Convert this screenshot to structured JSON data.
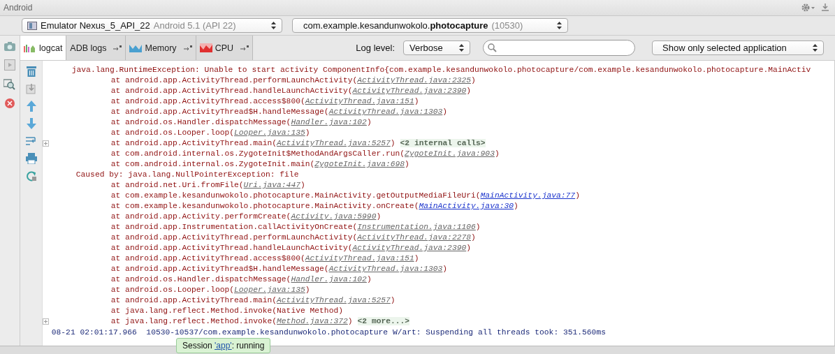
{
  "window": {
    "title": "Android"
  },
  "device_selector": {
    "device": "Emulator Nexus_5_API_22",
    "detail": "Android 5.1 (API 22)"
  },
  "process_selector": {
    "process": "com.example.kesandunwokolo.**photocapture**",
    "pid": "(10530)"
  },
  "tabs": [
    {
      "label": "logcat",
      "kind": "logcat",
      "selected": true,
      "detachable": false
    },
    {
      "label": "ADB logs",
      "kind": "adb",
      "selected": false,
      "detachable": true
    },
    {
      "label": "Memory",
      "kind": "memory",
      "selected": false,
      "detachable": true
    },
    {
      "label": "CPU",
      "kind": "cpu",
      "selected": false,
      "detachable": true
    }
  ],
  "log_level": {
    "label": "Log level:",
    "value": "Verbose"
  },
  "filter": {
    "value": "Show only selected application"
  },
  "log_lines": [
    {
      "kind": "exception",
      "segments": [
        {
          "kind": "text",
          "text": "java.lang.RuntimeException: Unable to start activity ComponentInfo{com.example.kesandunwokolo.photocapture/com.example.kesandunwokolo.photocapture.MainActiv"
        }
      ]
    },
    {
      "kind": "frame",
      "segments": [
        {
          "kind": "text",
          "text": "at android.app.ActivityThread.performLaunchActivity("
        },
        {
          "kind": "link",
          "text": "ActivityThread.java:2325"
        },
        {
          "kind": "text",
          "text": ")"
        }
      ]
    },
    {
      "kind": "frame",
      "segments": [
        {
          "kind": "text",
          "text": "at android.app.ActivityThread.handleLaunchActivity("
        },
        {
          "kind": "link",
          "text": "ActivityThread.java:2390"
        },
        {
          "kind": "text",
          "text": ")"
        }
      ]
    },
    {
      "kind": "frame",
      "segments": [
        {
          "kind": "text",
          "text": "at android.app.ActivityThread.access$800("
        },
        {
          "kind": "link",
          "text": "ActivityThread.java:151"
        },
        {
          "kind": "text",
          "text": ")"
        }
      ]
    },
    {
      "kind": "frame",
      "segments": [
        {
          "kind": "text",
          "text": "at android.app.ActivityThread$H.handleMessage("
        },
        {
          "kind": "link",
          "text": "ActivityThread.java:1303"
        },
        {
          "kind": "text",
          "text": ")"
        }
      ]
    },
    {
      "kind": "frame",
      "segments": [
        {
          "kind": "text",
          "text": "at android.os.Handler.dispatchMessage("
        },
        {
          "kind": "link",
          "text": "Handler.java:102"
        },
        {
          "kind": "text",
          "text": ")"
        }
      ]
    },
    {
      "kind": "frame",
      "segments": [
        {
          "kind": "text",
          "text": "at android.os.Looper.loop("
        },
        {
          "kind": "link",
          "text": "Looper.java:135"
        },
        {
          "kind": "text",
          "text": ")"
        }
      ]
    },
    {
      "kind": "frame",
      "segments": [
        {
          "kind": "text",
          "text": "at android.app.ActivityThread.main("
        },
        {
          "kind": "link",
          "text": "ActivityThread.java:5257"
        },
        {
          "kind": "text",
          "text": ")"
        },
        {
          "kind": "fold",
          "text": "<2 internal calls>"
        }
      ]
    },
    {
      "kind": "frame",
      "segments": [
        {
          "kind": "text",
          "text": "at com.android.internal.os.ZygoteInit$MethodAndArgsCaller.run("
        },
        {
          "kind": "link",
          "text": "ZygoteInit.java:903"
        },
        {
          "kind": "text",
          "text": ")"
        }
      ]
    },
    {
      "kind": "frame",
      "segments": [
        {
          "kind": "text",
          "text": "at com.android.internal.os.ZygoteInit.main("
        },
        {
          "kind": "link",
          "text": "ZygoteInit.java:698"
        },
        {
          "kind": "text",
          "text": ")"
        }
      ]
    },
    {
      "kind": "cause",
      "segments": [
        {
          "kind": "text",
          "text": "Caused by: java.lang.NullPointerException: file"
        }
      ]
    },
    {
      "kind": "frame",
      "segments": [
        {
          "kind": "text",
          "text": "at android.net.Uri.fromFile("
        },
        {
          "kind": "link",
          "text": "Uri.java:447"
        },
        {
          "kind": "text",
          "text": ")"
        }
      ]
    },
    {
      "kind": "frame",
      "segments": [
        {
          "kind": "text",
          "text": "at com.example.kesandunwokolo.photocapture.MainActivity.getOutputMediaFileUri("
        },
        {
          "kind": "app_link",
          "text": "MainActivity.java:77"
        },
        {
          "kind": "text",
          "text": ")"
        }
      ]
    },
    {
      "kind": "frame",
      "segments": [
        {
          "kind": "text",
          "text": "at com.example.kesandunwokolo.photocapture.MainActivity.onCreate("
        },
        {
          "kind": "app_link",
          "text": "MainActivity.java:30"
        },
        {
          "kind": "text",
          "text": ")"
        }
      ]
    },
    {
      "kind": "frame",
      "segments": [
        {
          "kind": "text",
          "text": "at android.app.Activity.performCreate("
        },
        {
          "kind": "link",
          "text": "Activity.java:5990"
        },
        {
          "kind": "text",
          "text": ")"
        }
      ]
    },
    {
      "kind": "frame",
      "segments": [
        {
          "kind": "text",
          "text": "at android.app.Instrumentation.callActivityOnCreate("
        },
        {
          "kind": "link",
          "text": "Instrumentation.java:1106"
        },
        {
          "kind": "text",
          "text": ")"
        }
      ]
    },
    {
      "kind": "frame",
      "segments": [
        {
          "kind": "text",
          "text": "at android.app.ActivityThread.performLaunchActivity("
        },
        {
          "kind": "link",
          "text": "ActivityThread.java:2278"
        },
        {
          "kind": "text",
          "text": ")"
        }
      ]
    },
    {
      "kind": "frame",
      "segments": [
        {
          "kind": "text",
          "text": "at android.app.ActivityThread.handleLaunchActivity("
        },
        {
          "kind": "link",
          "text": "ActivityThread.java:2390"
        },
        {
          "kind": "text",
          "text": ")"
        }
      ]
    },
    {
      "kind": "frame",
      "segments": [
        {
          "kind": "text",
          "text": "at android.app.ActivityThread.access$800("
        },
        {
          "kind": "link",
          "text": "ActivityThread.java:151"
        },
        {
          "kind": "text",
          "text": ")"
        }
      ]
    },
    {
      "kind": "frame",
      "segments": [
        {
          "kind": "text",
          "text": "at android.app.ActivityThread$H.handleMessage("
        },
        {
          "kind": "link",
          "text": "ActivityThread.java:1303"
        },
        {
          "kind": "text",
          "text": ")"
        }
      ]
    },
    {
      "kind": "frame",
      "segments": [
        {
          "kind": "text",
          "text": "at android.os.Handler.dispatchMessage("
        },
        {
          "kind": "link",
          "text": "Handler.java:102"
        },
        {
          "kind": "text",
          "text": ")"
        }
      ]
    },
    {
      "kind": "frame",
      "segments": [
        {
          "kind": "text",
          "text": "at android.os.Looper.loop("
        },
        {
          "kind": "link",
          "text": "Looper.java:135"
        },
        {
          "kind": "text",
          "text": ")"
        }
      ]
    },
    {
      "kind": "frame",
      "segments": [
        {
          "kind": "text",
          "text": "at android.app.ActivityThread.main("
        },
        {
          "kind": "link",
          "text": "ActivityThread.java:5257"
        },
        {
          "kind": "text",
          "text": ")"
        }
      ]
    },
    {
      "kind": "frame",
      "segments": [
        {
          "kind": "text",
          "text": "at java.lang.reflect.Method.invoke(Native Method)"
        }
      ]
    },
    {
      "kind": "frame",
      "segments": [
        {
          "kind": "text",
          "text": "at java.lang.reflect.Method.invoke("
        },
        {
          "kind": "link",
          "text": "Method.java:372"
        },
        {
          "kind": "text",
          "text": ")"
        },
        {
          "kind": "fold",
          "text": "<2 more...>"
        }
      ]
    },
    {
      "kind": "info",
      "segments": [
        {
          "kind": "text",
          "text": "08-21 02:01:17.966  10530-10537/com.example.kesandunwokolo.photocapture W/art: Suspending all threads took: 351.560ms"
        }
      ]
    }
  ],
  "tooltip": {
    "prefix": "Session ",
    "link": "'app'",
    "suffix": ": running"
  }
}
